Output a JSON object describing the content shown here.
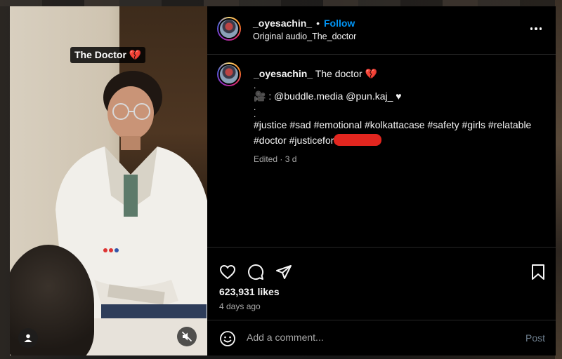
{
  "video": {
    "caption": "The Doctor 💔"
  },
  "header": {
    "username": "_oyesachin_",
    "separator": "•",
    "follow_label": "Follow",
    "audio": "Original audio_The_doctor"
  },
  "post": {
    "username": "_oyesachin_",
    "title": "The doctor 💔",
    "dot1": ".",
    "credits": "🎥 : @buddle.media @pun.kaj_ ♥",
    "dot2": ".",
    "dot3": ".",
    "hashtags_line1": "#justice #sad #emotional #kolkattacase #safety #girls #relatable",
    "hashtags_line2": "#doctor #justicefor",
    "edited": "Edited · 3 d"
  },
  "footer": {
    "likes": "623,931 likes",
    "date": "4 days ago",
    "comment_placeholder": "Add a comment...",
    "post_label": "Post"
  },
  "colors": {
    "follow": "#0095f6",
    "muted_text": "#a8a8a8",
    "redaction": "#e2261f"
  }
}
